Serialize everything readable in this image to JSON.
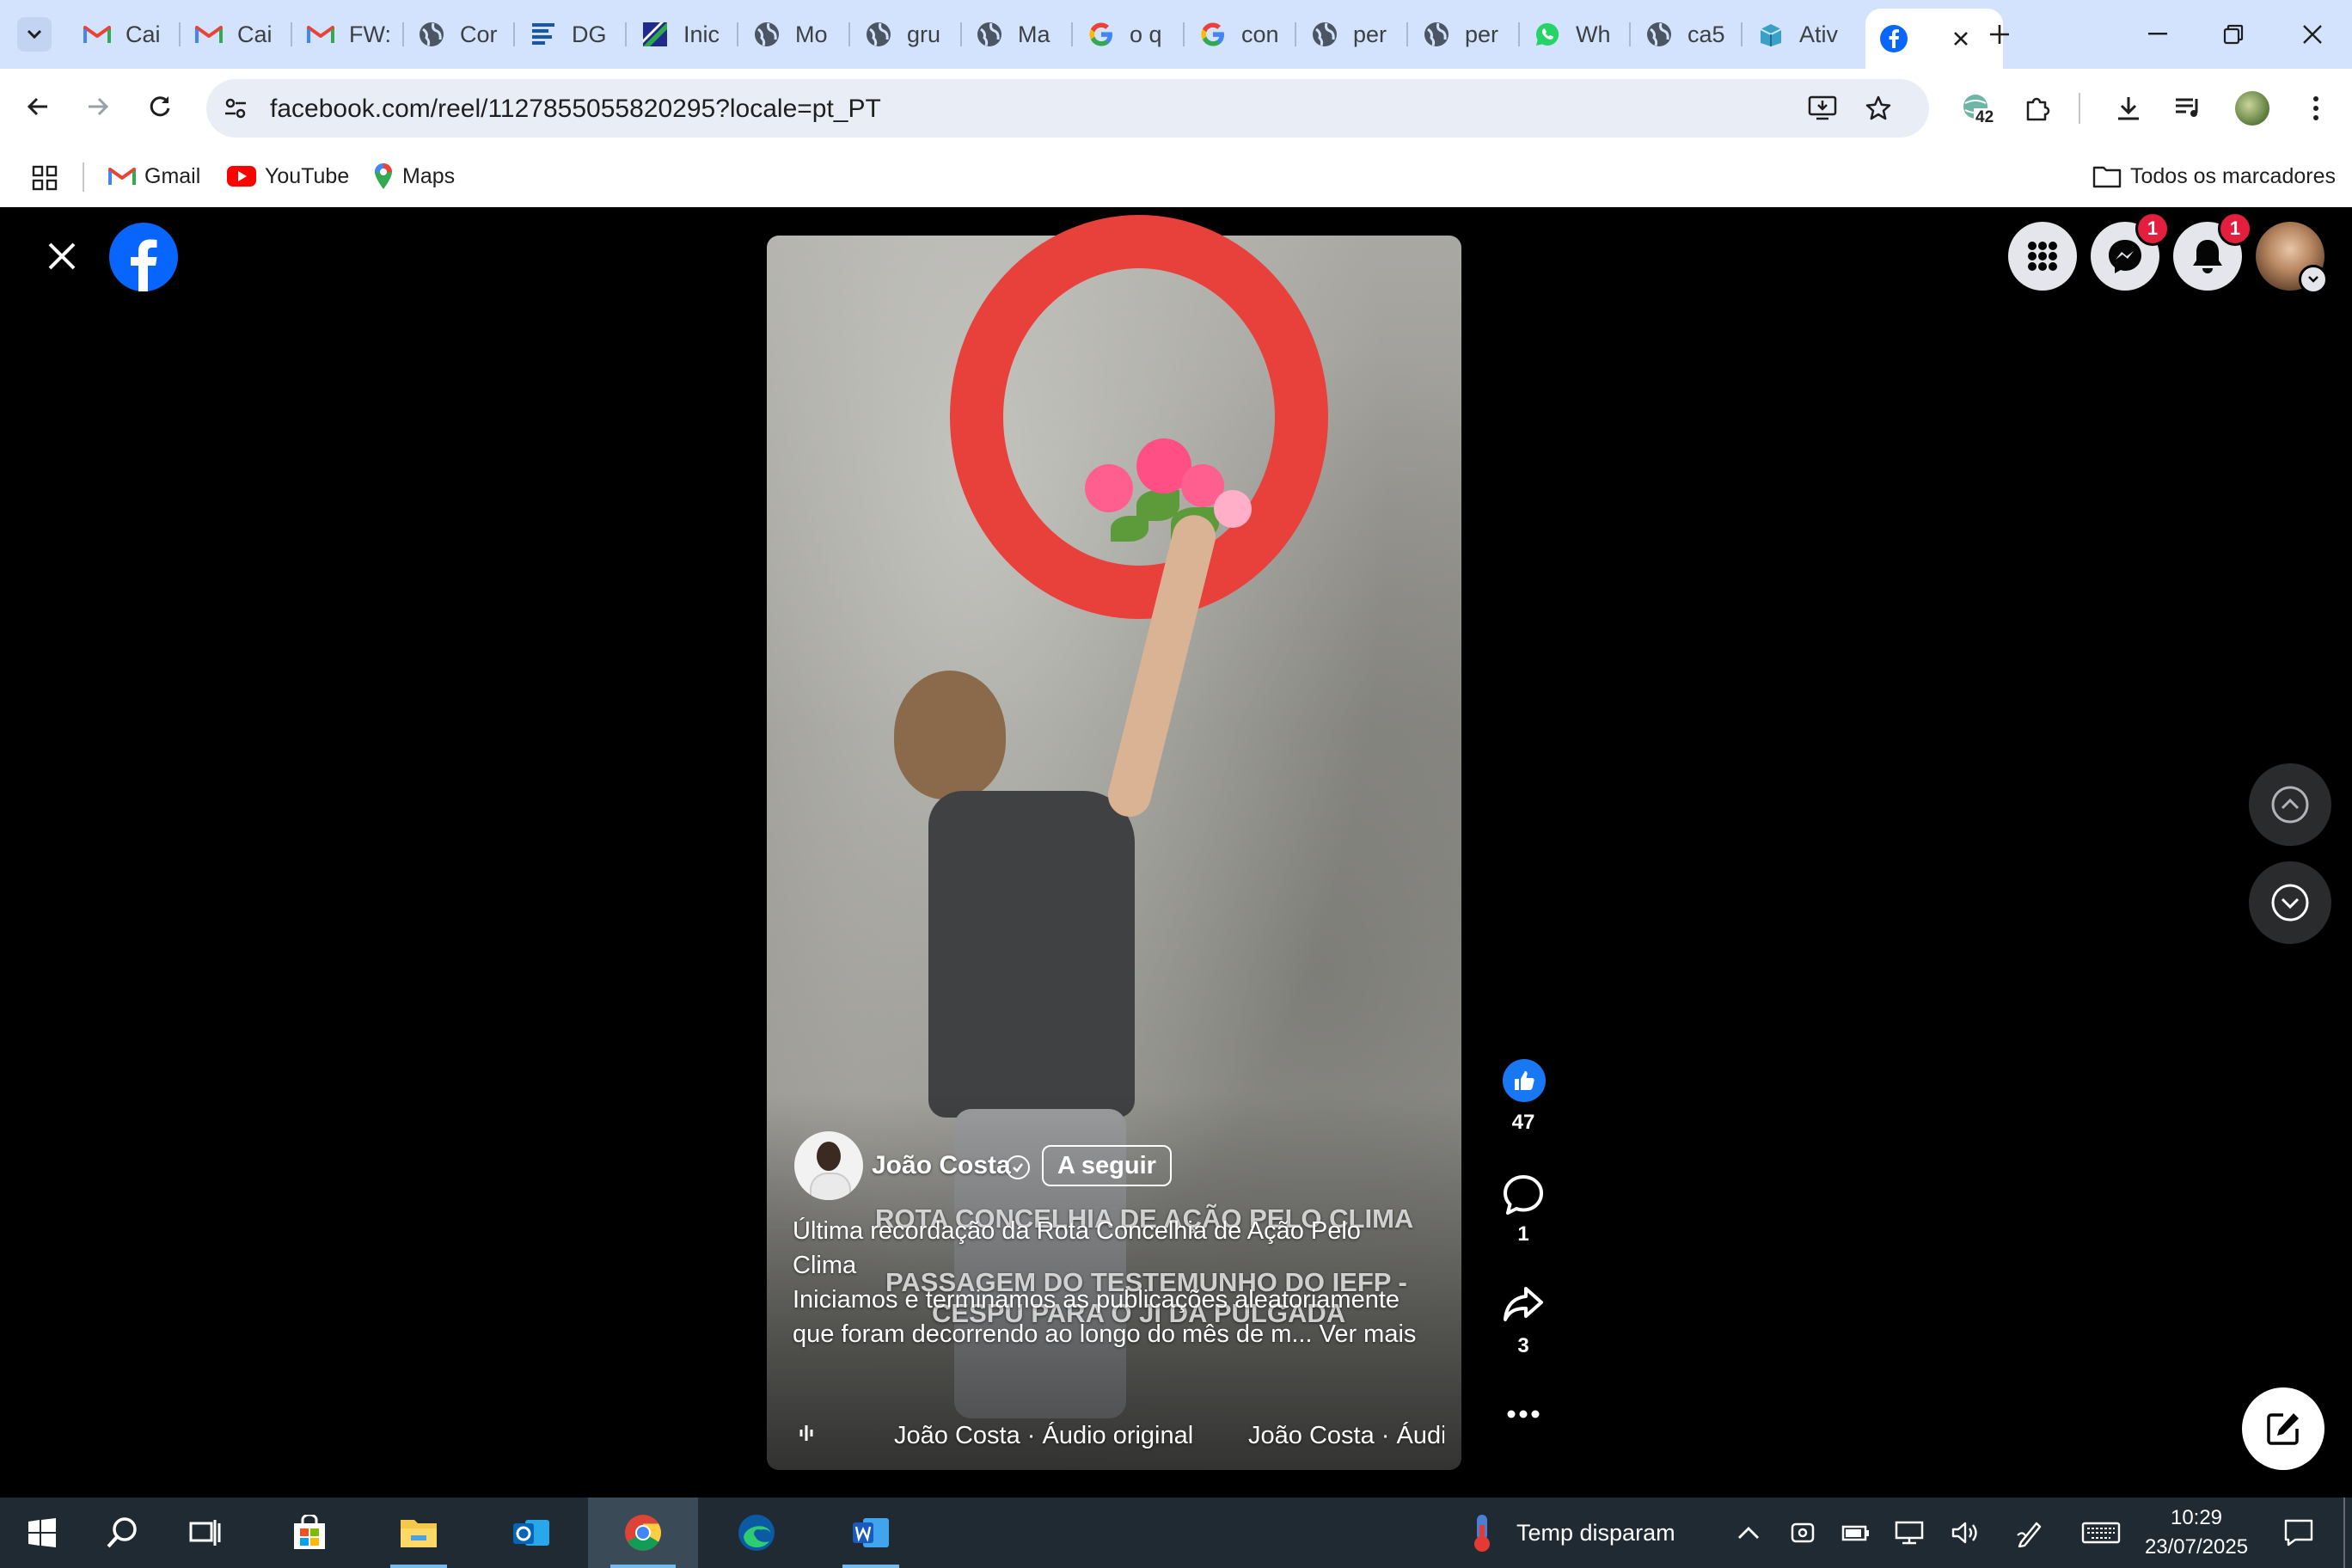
{
  "browser": {
    "tabs": [
      {
        "title": "Cai",
        "icon": "gmail-icon"
      },
      {
        "title": "Cai",
        "icon": "gmail-icon"
      },
      {
        "title": "FW:",
        "icon": "gmail-icon"
      },
      {
        "title": "Cor",
        "icon": "globe-icon"
      },
      {
        "title": "DG",
        "icon": "dg-icon"
      },
      {
        "title": "Inic",
        "icon": "diagonal-logo-icon"
      },
      {
        "title": "Mo",
        "icon": "globe-icon"
      },
      {
        "title": "gru",
        "icon": "globe-icon"
      },
      {
        "title": "Ma",
        "icon": "globe-icon"
      },
      {
        "title": "o q",
        "icon": "google-icon"
      },
      {
        "title": "con",
        "icon": "google-icon"
      },
      {
        "title": "per",
        "icon": "globe-icon"
      },
      {
        "title": "per",
        "icon": "globe-icon"
      },
      {
        "title": "Wh",
        "icon": "whatsapp-icon"
      },
      {
        "title": "ca5",
        "icon": "globe-icon"
      },
      {
        "title": "Ativ",
        "icon": "ativ-icon"
      }
    ],
    "active_tab": {
      "icon": "facebook-icon"
    },
    "url": "facebook.com/reel/1127855055820295?locale=pt_PT",
    "extension_badge": "42",
    "bookmarks": [
      {
        "label": "Gmail",
        "icon": "gmail-icon"
      },
      {
        "label": "YouTube",
        "icon": "youtube-icon"
      },
      {
        "label": "Maps",
        "icon": "maps-icon"
      }
    ],
    "all_bookmarks_label": "Todos os marcadores"
  },
  "facebook": {
    "messenger_badge": "1",
    "notifications_badge": "1",
    "reel": {
      "author": "João Costa",
      "follow_label": "A seguir",
      "caption_title": "Última recordação da Rota Concelhia de Ação Pelo Clima",
      "caption_body": "Iniciamos e terminamos as publicações aleatoriamente que foram decorrendo ao longo do mês de m...",
      "see_more": "Ver mais",
      "overlay_line1": "ROTA CONCELHIA DE AÇÃO PELO CLIMA",
      "overlay_line2": "PASSAGEM DO TESTEMUNHO DO IEFP -",
      "overlay_line3": "CESPU PARA O JI DA PULGADA",
      "audio_1": "João Costa · Áudio original",
      "audio_2": "João Costa · Áudi",
      "likes": "47",
      "comments": "1",
      "shares": "3"
    }
  },
  "taskbar": {
    "weather_text": "Temp disparam",
    "time": "10:29",
    "date": "23/07/2025"
  },
  "colors": {
    "facebook_blue": "#0866ff",
    "tabstrip_bg": "#d3e3fd",
    "badge_red": "#e41e3f",
    "taskbar_bg": "#1f2a33"
  }
}
